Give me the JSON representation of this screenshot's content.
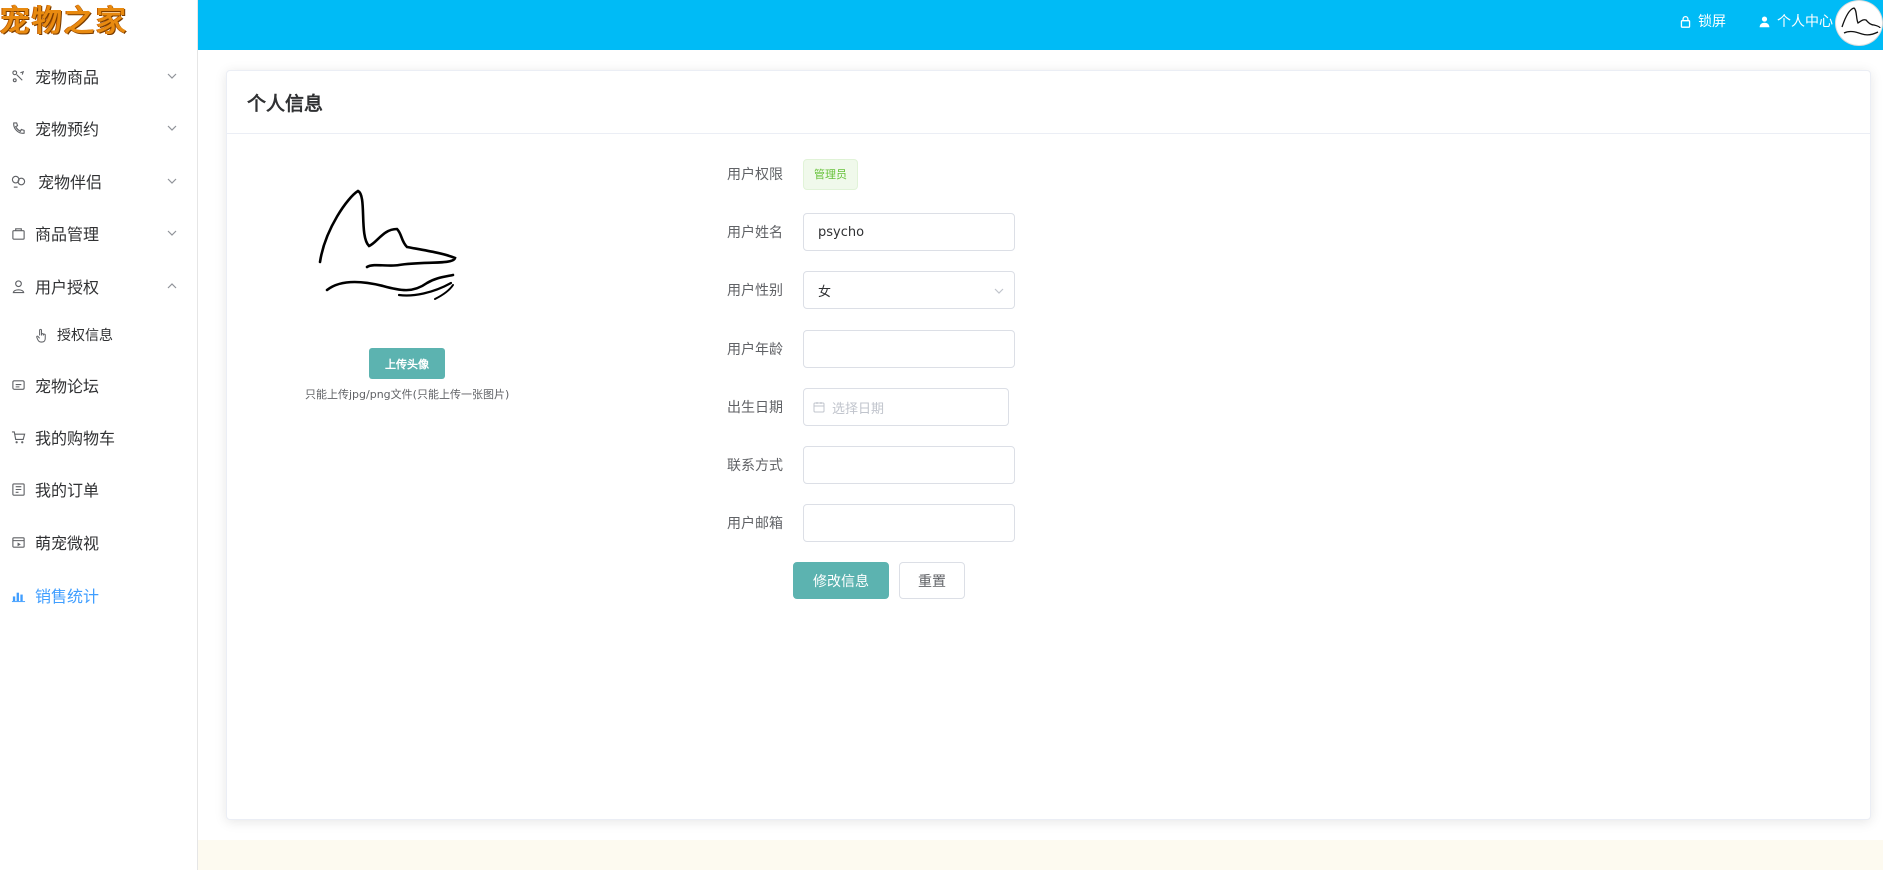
{
  "app": {
    "logo_text": "宠物之家",
    "accent_color": "#00bbf6",
    "primary_button_color": "#5cb3b0",
    "active_menu_color": "#409eff"
  },
  "header": {
    "lock_label": "锁屏",
    "lock_icon": "lock-icon",
    "profile_label": "个人中心",
    "profile_icon": "user-icon"
  },
  "sidebar": {
    "items": [
      {
        "label": "宠物商品",
        "icon": "pet-goods-icon",
        "arrow": "down"
      },
      {
        "label": "宠物预约",
        "icon": "phone-icon",
        "arrow": "down"
      },
      {
        "label": "宠物伴侣",
        "icon": "partner-icon",
        "arrow": "down"
      },
      {
        "label": "商品管理",
        "icon": "bag-icon",
        "arrow": "down"
      },
      {
        "label": "用户授权",
        "icon": "user-icon",
        "arrow": "up"
      },
      {
        "label": "授权信息",
        "icon": "hand-pointer-icon",
        "submenu": true
      },
      {
        "label": "宠物论坛",
        "icon": "chat-icon"
      },
      {
        "label": "我的购物车",
        "icon": "cart-icon"
      },
      {
        "label": "我的订单",
        "icon": "order-icon"
      },
      {
        "label": "萌宠微视",
        "icon": "video-icon"
      },
      {
        "label": "销售统计",
        "icon": "chart-icon",
        "active": true
      }
    ]
  },
  "main": {
    "title": "个人信息",
    "upload": {
      "button_label": "上传头像",
      "tip": "只能上传jpg/png文件(只能上传一张图片)"
    },
    "form": {
      "role_label": "用户权限",
      "role_value": "管理员",
      "name_label": "用户姓名",
      "name_value": "psycho",
      "gender_label": "用户性别",
      "gender_value": "女",
      "age_label": "用户年龄",
      "age_value": "",
      "birth_label": "出生日期",
      "birth_placeholder": "选择日期",
      "contact_label": "联系方式",
      "contact_value": "",
      "email_label": "用户邮箱",
      "email_value": "",
      "submit_label": "修改信息",
      "reset_label": "重置"
    }
  }
}
